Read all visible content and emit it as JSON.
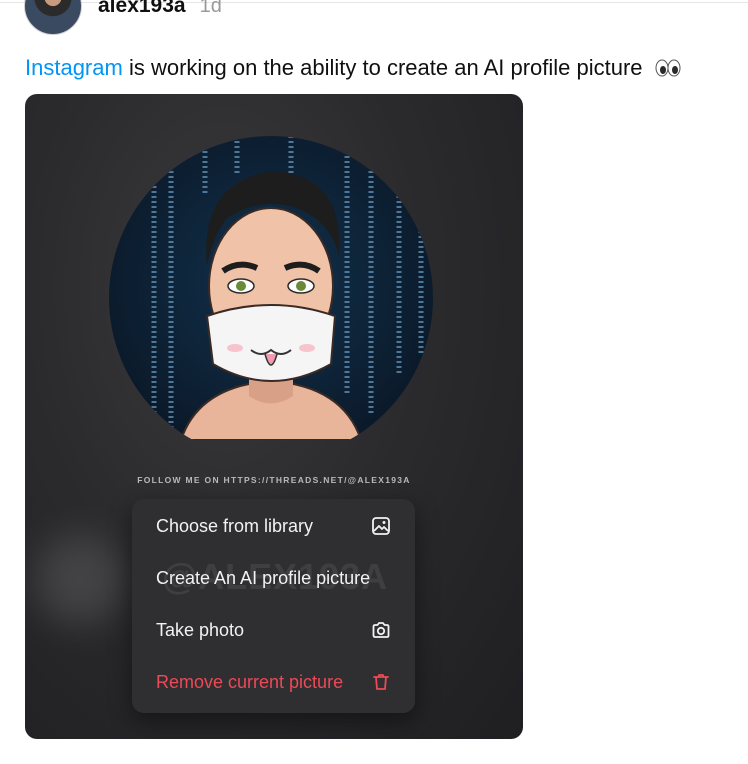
{
  "post": {
    "author": "alex193a",
    "time": "1d",
    "link_text": "Instagram",
    "text": " is working on the ability to create an AI profile picture",
    "emoji": "eyes"
  },
  "screenshot": {
    "caption": "FOLLOW ME ON HTTPS://THREADS.NET/@ALEX193A",
    "watermark": "@ALEX193A",
    "menu": {
      "choose_library": "Choose from library",
      "create_ai": "Create An AI profile picture",
      "take_photo": "Take photo",
      "remove": "Remove current picture"
    },
    "colors": {
      "danger": "#ed4956",
      "link": "#0095f6"
    }
  }
}
